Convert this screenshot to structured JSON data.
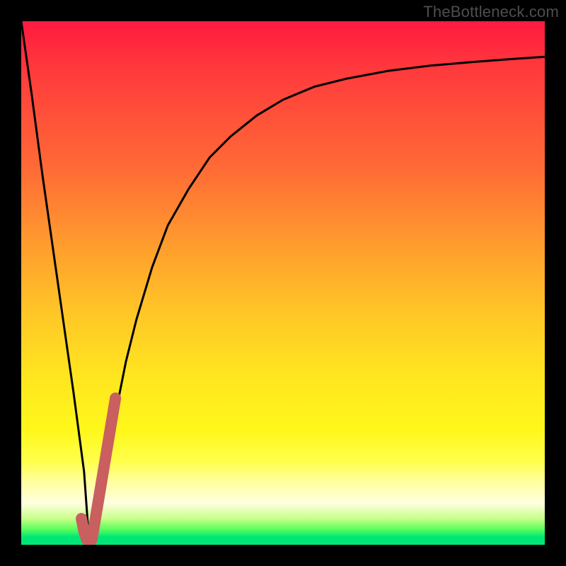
{
  "watermark": "TheBottleneck.com",
  "colors": {
    "background": "#000000",
    "curve": "#000000",
    "highlight": "#c95f5f",
    "gradient_top": "#ff1a3f",
    "gradient_bottom": "#00e676"
  },
  "chart_data": {
    "type": "line",
    "title": "",
    "xlabel": "",
    "ylabel": "",
    "xlim": [
      0,
      100
    ],
    "ylim": [
      0,
      100
    ],
    "grid": false,
    "legend": false,
    "series": [
      {
        "name": "bottleneck-curve",
        "x": [
          0,
          2,
          4,
          6,
          8,
          10,
          12,
          13,
          14,
          16,
          18,
          20,
          22,
          25,
          28,
          32,
          36,
          40,
          45,
          50,
          56,
          62,
          70,
          78,
          86,
          94,
          100
        ],
        "y": [
          100,
          86,
          71,
          57,
          43,
          29,
          14,
          0,
          4,
          14,
          25,
          35,
          43,
          53,
          61,
          68,
          74,
          78,
          82,
          85,
          87.5,
          89,
          90.5,
          91.5,
          92.2,
          92.8,
          93.2
        ]
      },
      {
        "name": "highlight-segment",
        "x": [
          11.5,
          12,
          12.5,
          13,
          13.5,
          14,
          15,
          16,
          17,
          18
        ],
        "y": [
          5,
          2.5,
          1,
          0.5,
          1,
          4,
          10,
          16,
          22,
          28
        ]
      }
    ],
    "annotations": []
  }
}
